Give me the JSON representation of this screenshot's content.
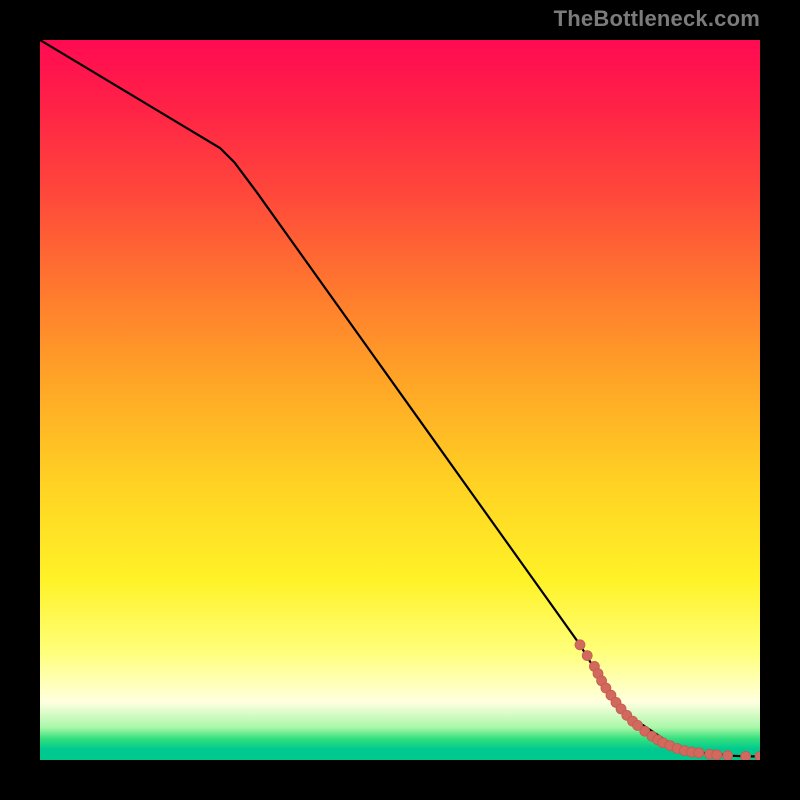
{
  "watermark": "TheBottleneck.com",
  "colors": {
    "line": "#000000",
    "marker_fill": "#d1695e",
    "marker_stroke": "#c65a4f"
  },
  "chart_data": {
    "type": "line",
    "title": "",
    "xlabel": "",
    "ylabel": "",
    "xlim": [
      0,
      100
    ],
    "ylim": [
      0,
      100
    ],
    "grid": false,
    "legend": false,
    "series": [
      {
        "name": "curve",
        "style": "line",
        "x": [
          0,
          5,
          10,
          15,
          20,
          25,
          27,
          30,
          35,
          40,
          45,
          50,
          55,
          60,
          65,
          70,
          75,
          78,
          80,
          82,
          85,
          88,
          90,
          92,
          94,
          96,
          98,
          100
        ],
        "y": [
          100,
          97,
          94,
          91,
          88,
          85,
          83,
          79,
          72,
          65,
          58,
          51,
          44,
          37,
          30,
          23,
          16,
          11,
          8,
          6,
          4,
          2,
          1.3,
          1,
          0.8,
          0.6,
          0.5,
          0.5
        ]
      },
      {
        "name": "markers",
        "style": "scatter",
        "x": [
          75,
          76,
          77,
          77.5,
          78,
          78.6,
          79.3,
          80,
          80.7,
          81.5,
          82.3,
          83,
          84,
          85,
          85.8,
          86.5,
          87.5,
          88.5,
          89.5,
          90.5,
          91.5,
          93,
          94,
          95.5,
          98,
          100
        ],
        "y": [
          16,
          14.5,
          13,
          12,
          11,
          10,
          9,
          8,
          7.1,
          6.2,
          5.4,
          4.8,
          4,
          3.3,
          2.8,
          2.4,
          2.0,
          1.6,
          1.3,
          1.1,
          1.0,
          0.8,
          0.7,
          0.6,
          0.5,
          0.5
        ]
      }
    ]
  }
}
